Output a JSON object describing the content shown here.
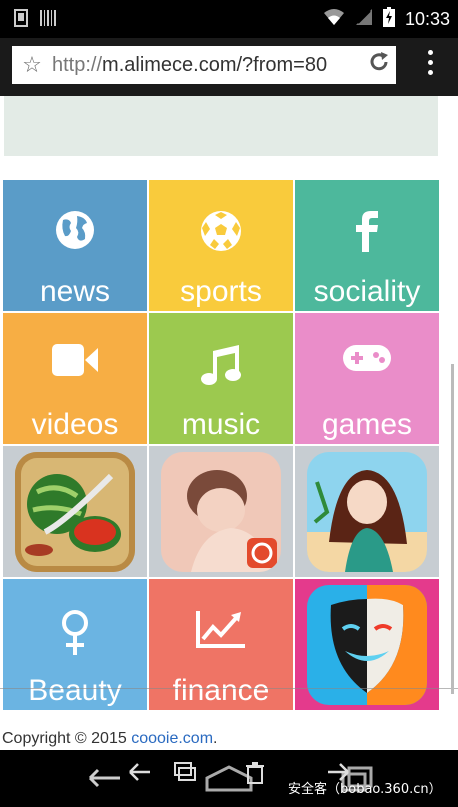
{
  "status_bar": {
    "time": "10:33"
  },
  "browser": {
    "url_scheme": "http://",
    "url_host": "m.alimece.com/?from=80"
  },
  "tiles": [
    {
      "label": "news",
      "icon": "globe-icon",
      "color": "#5a9cc8"
    },
    {
      "label": "sports",
      "icon": "soccer-ball-icon",
      "color": "#f9cb3c"
    },
    {
      "label": "sociality",
      "icon": "facebook-icon",
      "color": "#4db89c"
    },
    {
      "label": "videos",
      "icon": "video-camera-icon",
      "color": "#f7ae44"
    },
    {
      "label": "music",
      "icon": "music-note-icon",
      "color": "#9cc94f"
    },
    {
      "label": "games",
      "icon": "gamepad-icon",
      "color": "#ea8dc9"
    },
    {
      "label": "",
      "icon": "fruit-ninja-app-icon",
      "color": "#c7cdd2"
    },
    {
      "label": "",
      "icon": "portrait-app-icon",
      "color": "#c7cdd2"
    },
    {
      "label": "",
      "icon": "anime-girl-app-icon",
      "color": "#c7cdd2"
    },
    {
      "label": "Beauty",
      "icon": "female-symbol-icon",
      "color": "#6bb4e2"
    },
    {
      "label": "finance",
      "icon": "chart-trend-icon",
      "color": "#ef7465"
    },
    {
      "label": "",
      "icon": "theater-mask-app-icon",
      "color": "#e43a8c"
    }
  ],
  "footer": {
    "prefix": "Copyright © 2015 ",
    "link": "coooie.com",
    "suffix": "."
  },
  "watermark": "安全客（bobao.360.cn）"
}
